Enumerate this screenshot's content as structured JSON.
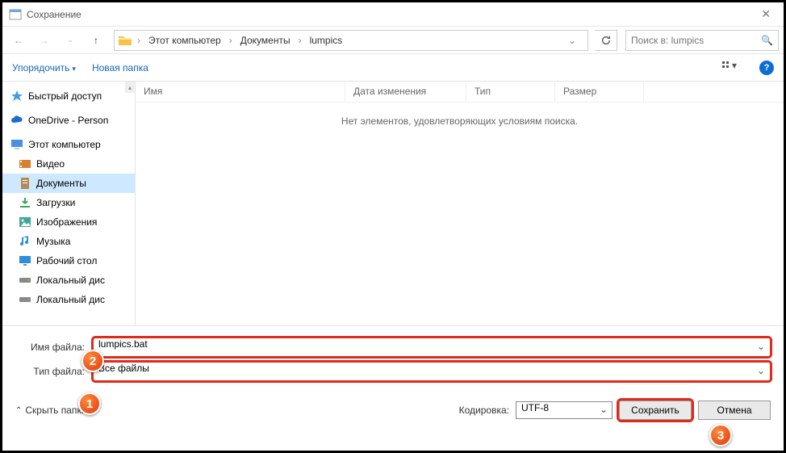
{
  "title": "Сохранение",
  "breadcrumb": {
    "root": "Этот компьютер",
    "p1": "Документы",
    "p2": "lumpics"
  },
  "search": {
    "placeholder": "Поиск в: lumpics"
  },
  "toolbar": {
    "organize": "Упорядочить",
    "newfolder": "Новая папка"
  },
  "columns": {
    "name": "Имя",
    "date": "Дата изменения",
    "type": "Тип",
    "size": "Размер"
  },
  "empty": "Нет элементов, удовлетворяющих условиям поиска.",
  "sidebar": {
    "quick": "Быстрый доступ",
    "onedrive": "OneDrive - Person",
    "pc": "Этот компьютер",
    "video": "Видео",
    "docs": "Документы",
    "downloads": "Загрузки",
    "images": "Изображения",
    "music": "Музыка",
    "desktop": "Рабочий стол",
    "localc": "Локальный дис",
    "locald": "Локальный дис"
  },
  "labels": {
    "filename": "Имя файла:",
    "filetype": "Тип файла:",
    "encoding": "Кодировка:",
    "hide": "Скрыть папки"
  },
  "filename": "lumpics.bat",
  "filetype": "Все файлы",
  "encoding": "UTF-8",
  "buttons": {
    "save": "Сохранить",
    "cancel": "Отмена"
  },
  "badges": {
    "b1": "1",
    "b2": "2",
    "b3": "3"
  }
}
